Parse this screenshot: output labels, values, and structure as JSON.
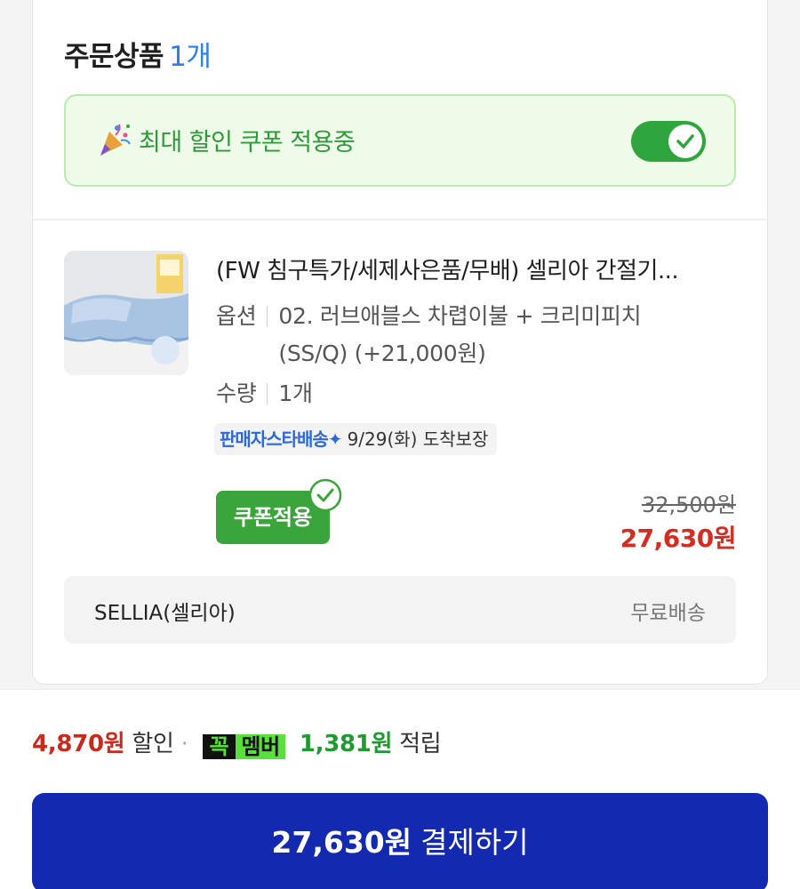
{
  "order": {
    "title": "주문상품",
    "count": "1개"
  },
  "coupon_banner": {
    "icon": "party-popper-icon",
    "text": "최대 할인 쿠폰 적용중",
    "toggle_on": true
  },
  "product": {
    "title": "(FW 침구특가/세제사은품/무배) 셀리아 간절기...",
    "option_label": "옵션",
    "option_value": "02. 러브애블스 차렵이불 + 크리미피치(SS/Q) (+21,000원)",
    "quantity_label": "수량",
    "quantity_value": "1개",
    "delivery_badge": "판매자스타배송✦",
    "delivery_date": "9/29(화) 도착보장",
    "coupon_button": "쿠폰적용",
    "price_original": "32,500원",
    "price_sale": "27,630원"
  },
  "seller": {
    "name": "SELLIA(셀리아)",
    "shipping": "무료배송"
  },
  "summary": {
    "discount": "4,870원",
    "discount_label": "할인",
    "separator": "·",
    "member_badge_a": "꼭",
    "member_badge_b": "멤버",
    "points": "1,381원",
    "points_label": "적립"
  },
  "pay_button": {
    "amount": "27,630원",
    "label": "결제하기"
  },
  "colors": {
    "accent_blue": "#2f7fe8",
    "toggle_green": "#2fa53e",
    "sale_red": "#d42c20",
    "pay_button": "#1229b0"
  }
}
